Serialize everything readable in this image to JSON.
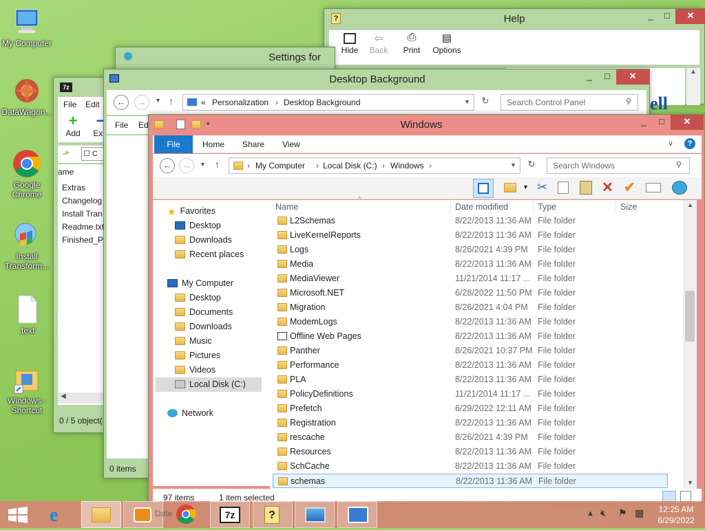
{
  "desktop": {
    "icons": [
      {
        "label": "My Computer"
      },
      {
        "label": "DataWagon..."
      },
      {
        "label": "Google Chrome"
      },
      {
        "label": "Install Transform..."
      },
      {
        "label": ".text"
      },
      {
        "label": "Windows - Shortcut"
      }
    ]
  },
  "help_window": {
    "title": "Help",
    "toolbar": [
      "Hide",
      "Back",
      "Print",
      "Options"
    ],
    "peek_text": "ell"
  },
  "settings_window": {
    "title": "Settings for"
  },
  "sevenzip_window": {
    "menu": [
      "File",
      "Edit"
    ],
    "toolbar": [
      "Add",
      "Extr"
    ],
    "column": "ame",
    "files": [
      "Extras",
      "Changelog",
      "Install Tran",
      "Readme.txt",
      "Finished_Pr"
    ],
    "status": "0 / 5 object("
  },
  "desktop_bg_window": {
    "title": "Desktop Background",
    "breadcrumb": [
      "«",
      "Personalization",
      "Desktop Background"
    ],
    "search_placeholder": "Search Control Panel",
    "menu": [
      "File",
      "Edi"
    ],
    "status": "0 items"
  },
  "explorer": {
    "title": "Windows",
    "ribbon_tabs": [
      "File",
      "Home",
      "Share",
      "View"
    ],
    "breadcrumb": [
      "My Computer",
      "Local Disk (C:)",
      "Windows"
    ],
    "search_placeholder": "Search Windows",
    "columns": {
      "name": "Name",
      "date": "Date modified",
      "type": "Type",
      "size": "Size"
    },
    "nav": {
      "favorites": "Favorites",
      "fav_items": [
        "Desktop",
        "Downloads",
        "Recent places"
      ],
      "computer": "My Computer",
      "pc_items": [
        "Desktop",
        "Documents",
        "Downloads",
        "Music",
        "Pictures",
        "Videos",
        "Local Disk (C:)"
      ],
      "network": "Network"
    },
    "rows": [
      {
        "name": "L2Schemas",
        "date": "8/22/2013 11:36 AM",
        "type": "File folder"
      },
      {
        "name": "LiveKernelReports",
        "date": "8/22/2013 11:36 AM",
        "type": "File folder"
      },
      {
        "name": "Logs",
        "date": "8/26/2021 4:39 PM",
        "type": "File folder"
      },
      {
        "name": "Media",
        "date": "8/22/2013 11:36 AM",
        "type": "File folder"
      },
      {
        "name": "MediaViewer",
        "date": "11/21/2014 11:17 ...",
        "type": "File folder"
      },
      {
        "name": "Microsoft.NET",
        "date": "6/28/2022 11:50 PM",
        "type": "File folder"
      },
      {
        "name": "Migration",
        "date": "8/26/2021 4:04 PM",
        "type": "File folder"
      },
      {
        "name": "ModemLogs",
        "date": "8/22/2013 11:36 AM",
        "type": "File folder"
      },
      {
        "name": "Offline Web Pages",
        "date": "8/22/2013 11:36 AM",
        "type": "File folder"
      },
      {
        "name": "Panther",
        "date": "8/26/2021 10:37 PM",
        "type": "File folder"
      },
      {
        "name": "Performance",
        "date": "8/22/2013 11:36 AM",
        "type": "File folder"
      },
      {
        "name": "PLA",
        "date": "8/22/2013 11:36 AM",
        "type": "File folder"
      },
      {
        "name": "PolicyDefinitions",
        "date": "11/21/2014 11:17 ...",
        "type": "File folder"
      },
      {
        "name": "Prefetch",
        "date": "6/29/2022 12:11 AM",
        "type": "File folder"
      },
      {
        "name": "Registration",
        "date": "8/22/2013 11:36 AM",
        "type": "File folder"
      },
      {
        "name": "rescache",
        "date": "8/26/2021 4:39 PM",
        "type": "File folder"
      },
      {
        "name": "Resources",
        "date": "8/22/2013 11:36 AM",
        "type": "File folder"
      },
      {
        "name": "SchCache",
        "date": "8/22/2013 11:36 AM",
        "type": "File folder"
      },
      {
        "name": "schemas",
        "date": "8/22/2013 11:36 AM",
        "type": "File folder"
      }
    ],
    "status_items": "97 items",
    "status_selected": "1 item selected"
  },
  "taskbar": {
    "peek_text": "Date",
    "clock_time": "12:25 AM",
    "clock_date": "6/29/2022"
  }
}
